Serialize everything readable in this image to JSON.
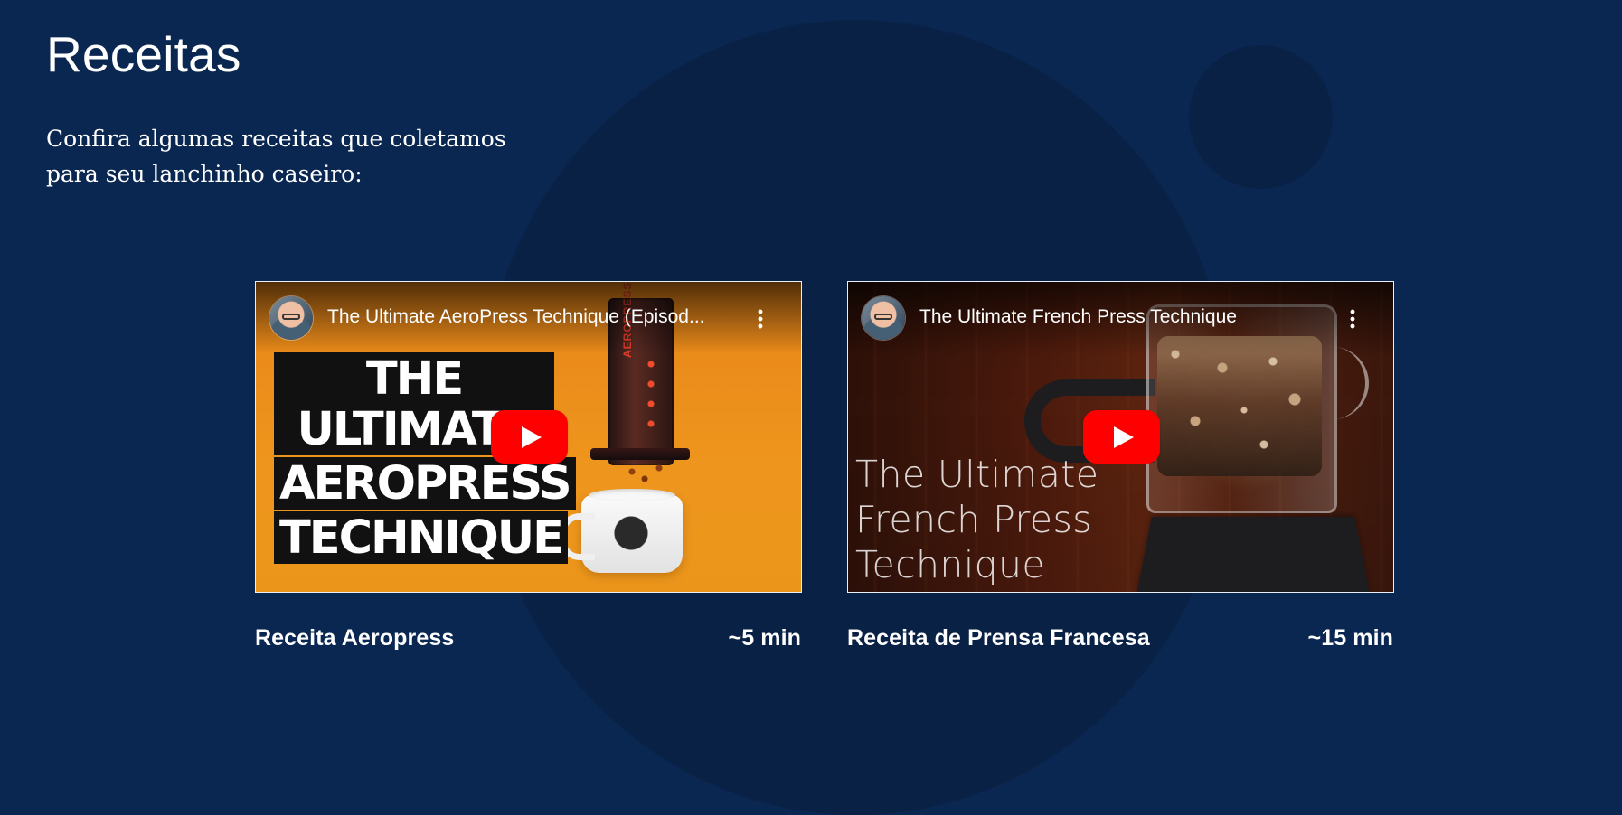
{
  "page": {
    "title": "Receitas",
    "subtitle": "Confira algumas receitas que coletamos para seu lanchinho caseiro:"
  },
  "colors": {
    "background": "#0a2751",
    "background_shape": "#0a2145",
    "youtube_red": "#ff0000",
    "card_border": "#e9eef7"
  },
  "videos": [
    {
      "title": "The Ultimate AeroPress Technique (Episod...",
      "thumbnail_text": [
        "THE ULTIMATE",
        "AEROPRESS",
        "TECHNIQUE"
      ],
      "recipe_name": "Receita Aeropress",
      "duration": "~5 min",
      "channel_avatar": "channel-avatar",
      "menu_icon": "more-vertical-icon",
      "play_icon": "youtube-play-icon"
    },
    {
      "title": "The Ultimate French Press Technique",
      "thumbnail_text": [
        "The Ultimate",
        "French Press",
        "Technique"
      ],
      "recipe_name": "Receita de Prensa Francesa",
      "duration": "~15 min",
      "channel_avatar": "channel-avatar",
      "menu_icon": "more-vertical-icon",
      "play_icon": "youtube-play-icon"
    }
  ]
}
